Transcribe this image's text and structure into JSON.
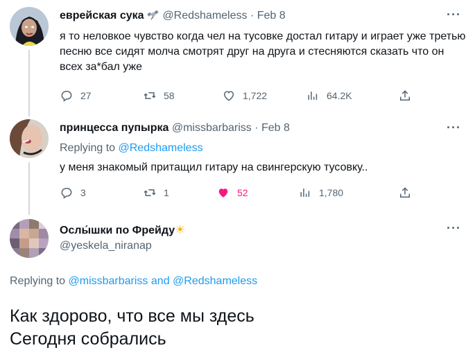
{
  "tweets": [
    {
      "name": "еврейская сука",
      "handle": "@Redshameless",
      "sep": "·",
      "date": "Feb 8",
      "more": "···",
      "text": "я то неловкое чувство когда чел на тусовке достал гитару и играет уже третью песню все сидят молча смотрят друг на друга и стесняются сказать что он всех за*бал уже",
      "stats": {
        "replies": "27",
        "retweets": "58",
        "likes": "1,722",
        "views": "64.2K"
      }
    },
    {
      "name": "принцесса пупырка",
      "handle": "@missbarbariss",
      "sep": "·",
      "date": "Feb 8",
      "more": "···",
      "replying_label": "Replying to",
      "replying_mention": "@Redshameless",
      "text": "у меня знакомый притащил гитару на свингерскую тусовку..",
      "stats": {
        "replies": "3",
        "retweets": "1",
        "likes": "52",
        "views": "1,780"
      }
    },
    {
      "name": "Ослы́шки по Фрейду",
      "name_emoji": "☀",
      "handle": "@yeskela_niranap",
      "more": "···",
      "replying_label": "Replying to",
      "replying_mention_1": "@missbarbariss",
      "replying_and": "and",
      "replying_mention_2": "@Redshameless",
      "text_line1": "Как здорово, что все мы здесь",
      "text_line2": "Сегодня собрались"
    }
  ],
  "colors": {
    "accent": "#1d9bf0",
    "like": "#f91880",
    "muted": "#536471"
  },
  "icons": [
    "reply-icon",
    "retweet-icon",
    "like-icon",
    "views-icon",
    "share-icon",
    "satellite-emoji-icon",
    "sun-emoji-icon"
  ]
}
